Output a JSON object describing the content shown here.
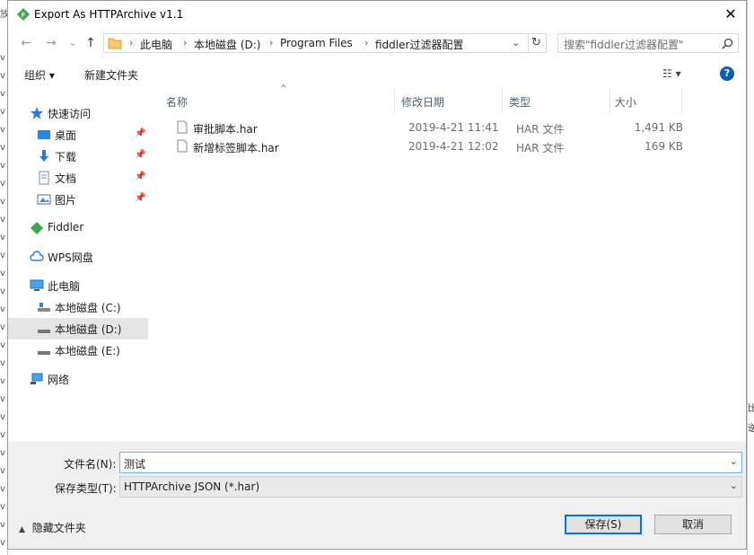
{
  "window": {
    "title": "Export As HTTPArchive v1.1",
    "close_glyph": "✕"
  },
  "background_app": {
    "left_chars": "v",
    "left_top_char": "放",
    "right_chars": [
      "比",
      "逆"
    ]
  },
  "nav": {
    "back_glyph": "←",
    "forward_glyph": "→",
    "down_glyph": "⌄",
    "up_glyph": "↑",
    "breadcrumbs": [
      "此电脑",
      "本地磁盘 (D:)",
      "Program Files",
      "fiddler过滤器配置"
    ],
    "separator": "›",
    "refresh_glyph": "↻",
    "search_placeholder": "搜索\"fiddler过滤器配置\""
  },
  "toolbar": {
    "organize": "组织 ▾",
    "new_folder": "新建文件夹",
    "view_glyph": "☷ ▾",
    "help_glyph": "?"
  },
  "sidebar": {
    "items": [
      {
        "label": "快速访问",
        "icon": "star-icon"
      },
      {
        "label": "桌面",
        "icon": "desktop-icon",
        "pinned": true
      },
      {
        "label": "下载",
        "icon": "download-icon",
        "pinned": true
      },
      {
        "label": "文档",
        "icon": "document-icon",
        "pinned": true
      },
      {
        "label": "图片",
        "icon": "picture-icon",
        "pinned": true
      },
      {
        "label": "Fiddler",
        "icon": "fiddler-icon"
      },
      {
        "label": "WPS网盘",
        "icon": "cloud-icon"
      },
      {
        "label": "此电脑",
        "icon": "computer-icon"
      },
      {
        "label": "本地磁盘 (C:)",
        "icon": "drive-icon"
      },
      {
        "label": "本地磁盘 (D:)",
        "icon": "drive-icon",
        "selected": true
      },
      {
        "label": "本地磁盘 (E:)",
        "icon": "drive-icon"
      },
      {
        "label": "网络",
        "icon": "network-icon"
      }
    ]
  },
  "columns": {
    "name": "名称",
    "modified": "修改日期",
    "type": "类型",
    "size": "大小"
  },
  "files": [
    {
      "name": "审批脚本.har",
      "modified": "2019-4-21 11:41",
      "type": "HAR 文件",
      "size": "1,491 KB"
    },
    {
      "name": "新增标签脚本.har",
      "modified": "2019-4-21 12:02",
      "type": "HAR 文件",
      "size": "169 KB"
    }
  ],
  "form": {
    "filename_label": "文件名(N):",
    "filename_value": "测试",
    "filetype_label": "保存类型(T):",
    "filetype_value": "HTTPArchive JSON (*.har)",
    "hide_folders": "隐藏文件夹",
    "save": "保存(S)",
    "cancel": "取消"
  },
  "colors": {
    "accent": "#0078d7",
    "header_text": "#4c607a",
    "selected_bg": "#e5e5e5",
    "bottom_bg": "#f0f0f0"
  }
}
